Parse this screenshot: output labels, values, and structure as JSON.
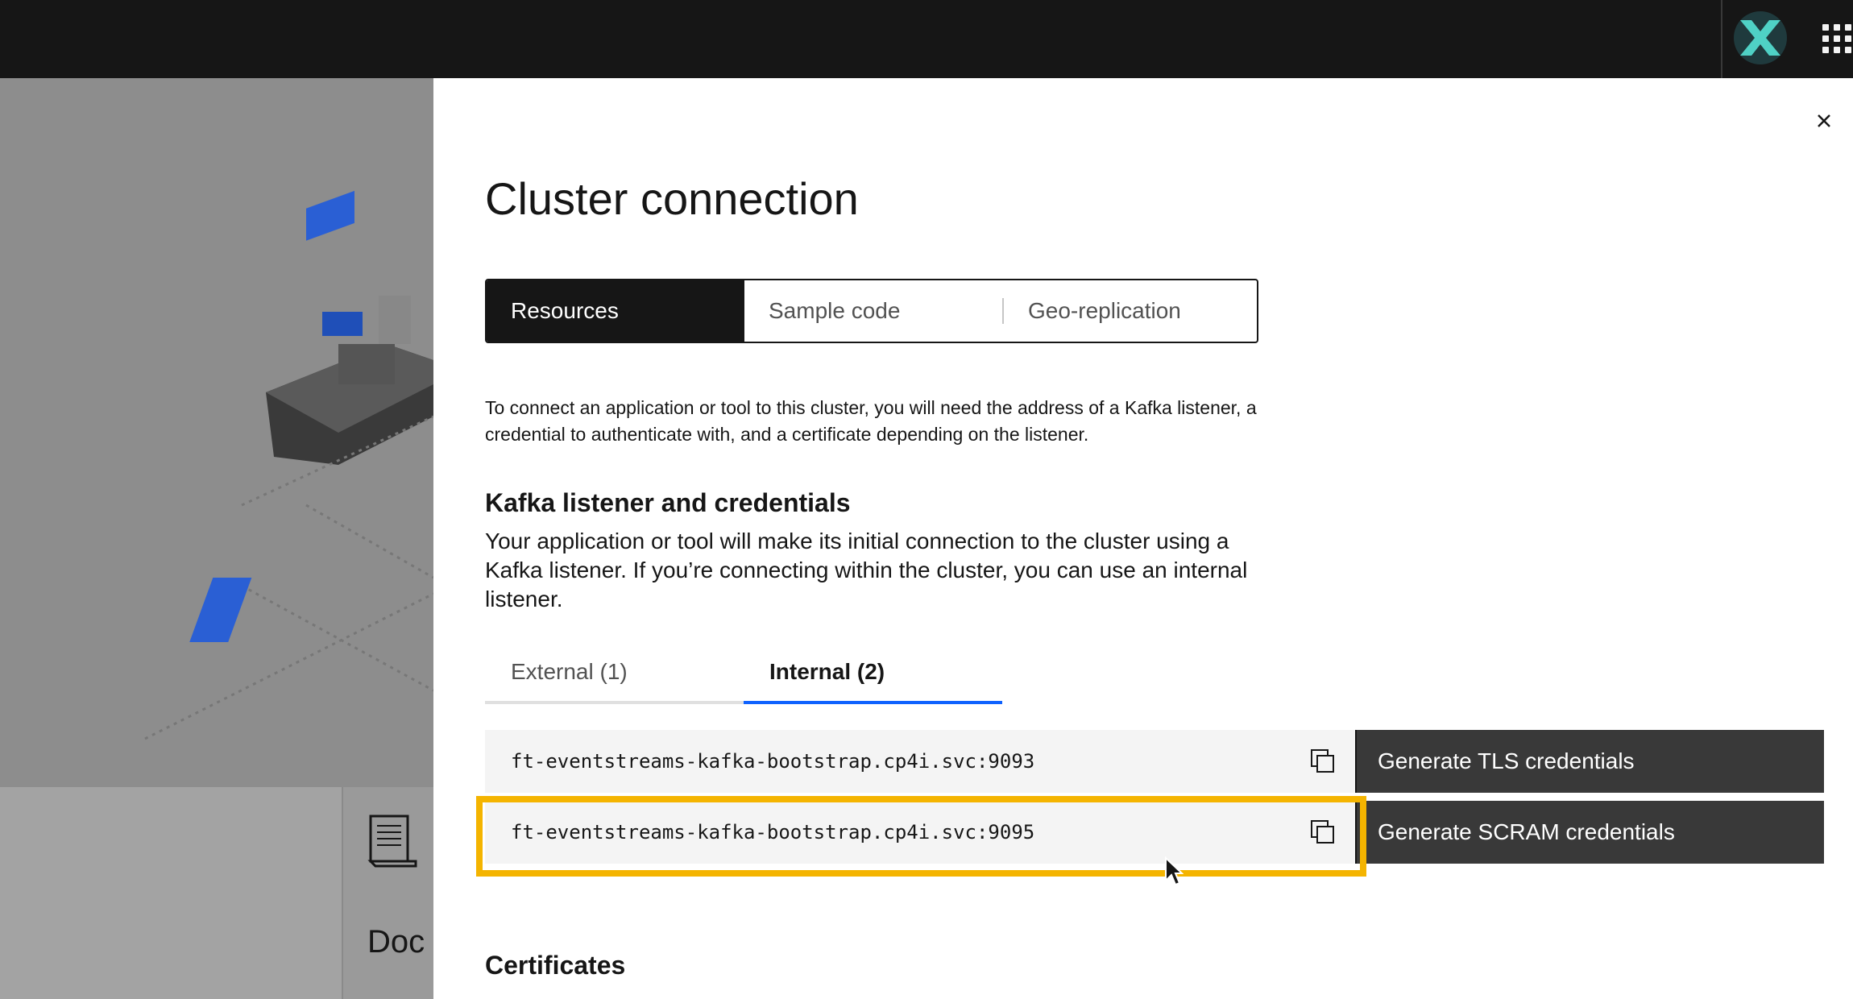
{
  "panel": {
    "title": "Cluster connection",
    "switcher": [
      "Resources",
      "Sample code",
      "Geo-replication"
    ],
    "intro": "To connect an application or tool to this cluster, you will need the address of a Kafka listener, a credential to authenticate with, and a certificate depending on the listener.",
    "listener_heading": "Kafka listener and credentials",
    "listener_desc": "Your application or tool will make its initial connection to the cluster using a Kafka listener. If you’re connecting within the cluster, you can use an internal listener.",
    "tabs": [
      "External (1)",
      "Internal (2)"
    ],
    "listeners": [
      {
        "address": "ft-eventstreams-kafka-bootstrap.cp4i.svc:9093",
        "button": "Generate TLS credentials"
      },
      {
        "address": "ft-eventstreams-kafka-bootstrap.cp4i.svc:9095",
        "button": "Generate SCRAM credentials"
      }
    ],
    "certificates_heading": "Certificates"
  },
  "background": {
    "card_text": "Doc"
  },
  "colors": {
    "topbar": "#161616",
    "accent": "#0f62fe",
    "highlight": "#f4b400",
    "button": "#393939"
  },
  "icons": [
    "close-icon",
    "copy-icon",
    "app-switcher-icon",
    "brand-logo-icon",
    "document-icon",
    "mouse-cursor-icon"
  ]
}
